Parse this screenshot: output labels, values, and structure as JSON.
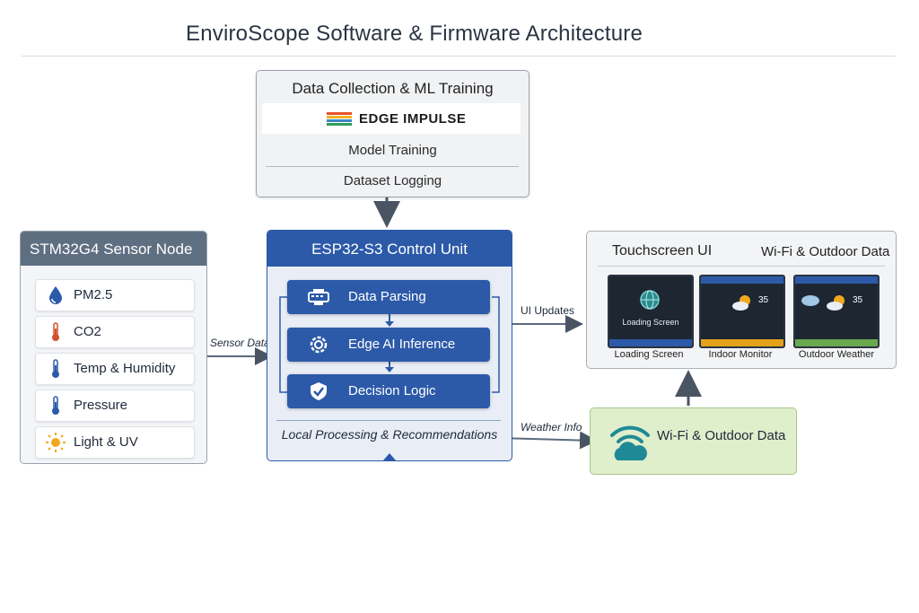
{
  "title": "EnviroScope Software & Firmware Architecture",
  "ml": {
    "heading": "Data Collection & ML Training",
    "logo_text": "EDGE IMPULSE",
    "rows": [
      "Model Training",
      "Dataset Logging"
    ]
  },
  "sensor_node": {
    "heading": "STM32G4 Sensor Node",
    "items": [
      {
        "label": "PM2.5",
        "icon": "droplet-icon"
      },
      {
        "label": "CO2",
        "icon": "thermometer-icon"
      },
      {
        "label": "Temp & Humidity",
        "icon": "thermometer-icon"
      },
      {
        "label": "Pressure",
        "icon": "thermometer-icon"
      },
      {
        "label": "Light & UV",
        "icon": "sun-icon"
      }
    ]
  },
  "control_unit": {
    "heading": "ESP32-S3 Control Unit",
    "steps": [
      {
        "label": "Data Parsing",
        "icon": "parser-icon"
      },
      {
        "label": "Edge AI Inference",
        "icon": "gear-icon"
      },
      {
        "label": "Decision Logic",
        "icon": "shield-icon"
      }
    ],
    "footer": "Local Processing & Recommendations"
  },
  "touchscreen": {
    "heading": "Touchscreen UI",
    "subheading": "Wi-Fi & Outdoor Data",
    "loading_text": "Loading Screen",
    "temp_value": "35",
    "screens": [
      {
        "caption": "Loading Screen"
      },
      {
        "caption": "Indoor Monitor"
      },
      {
        "caption": "Outdoor Weather"
      }
    ]
  },
  "wifi": {
    "label": "Wi-Fi & Outdoor Data"
  },
  "flows": {
    "sensor_data": "Sensor Data",
    "ui_updates": "UI Updates",
    "weather_info": "Weather Info"
  },
  "colors": {
    "accent": "#2c5aa8",
    "sensor_header": "#5f6f82",
    "wifi_fill": "#dfeecb",
    "indoor_bar": "#e3a21a",
    "outdoor_bar": "#6aa84f",
    "loading_bar": "#2c5aa8"
  }
}
